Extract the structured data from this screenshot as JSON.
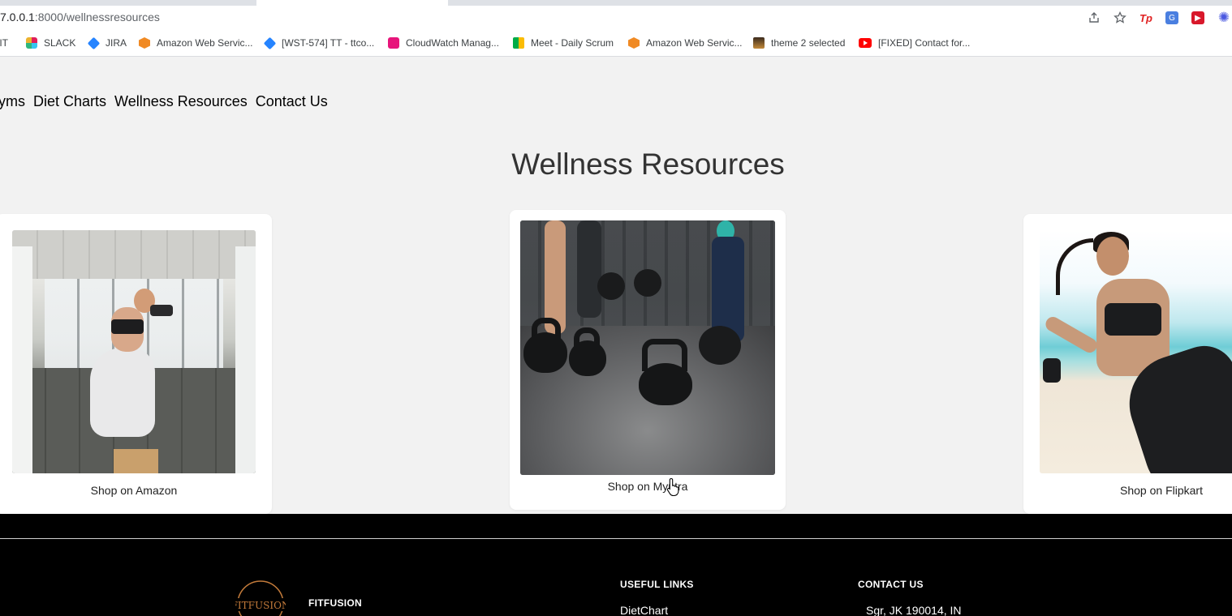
{
  "browser": {
    "url_prefix": "7.0.0.1",
    "url_rest": ":8000/wellnessresources",
    "bookmarks": [
      {
        "label": "GIT",
        "icon": "git-icon"
      },
      {
        "label": "SLACK",
        "icon": "slack-icon"
      },
      {
        "label": "JIRA",
        "icon": "jira-icon"
      },
      {
        "label": "Amazon Web Servic...",
        "icon": "aws-icon"
      },
      {
        "label": "[WST-574] TT - ttco...",
        "icon": "jira-icon"
      },
      {
        "label": "CloudWatch Manag...",
        "icon": "cloudwatch-icon"
      },
      {
        "label": "Meet - Daily Scrum",
        "icon": "google-meet-icon"
      },
      {
        "label": "Amazon Web Servic...",
        "icon": "aws-icon"
      },
      {
        "label": "theme 2 selected",
        "icon": "theme-icon"
      },
      {
        "label": "[FIXED] Contact for...",
        "icon": "youtube-icon"
      }
    ],
    "toolbar_icons": [
      "share-icon",
      "bookmark-star-icon",
      "tp-extension-icon",
      "translate-extension-icon",
      "red-extension-icon",
      "gear-extension-icon"
    ],
    "ext_tp_label": "Tp",
    "ext_tr_label": "G",
    "ext_red_label": "▶"
  },
  "nav": {
    "items": [
      "yms",
      "Diet Charts",
      "Wellness Resources",
      "Contact Us"
    ]
  },
  "page": {
    "title": "Wellness Resources"
  },
  "cards": [
    {
      "caption": "Shop on Amazon",
      "image": "woman squatting with dumbbell in gym"
    },
    {
      "caption": "Shop on Myntra",
      "image": "kettlebells on gym floor"
    },
    {
      "caption": "Shop on Flipkart",
      "image": "woman kicking on beach"
    }
  ],
  "footer": {
    "brand": "FITFUSION",
    "logo_text": "FITFUSION",
    "useful_links_heading": "USEFUL LINKS",
    "useful_links": [
      "DietChart"
    ],
    "contact_heading": "CONTACT US",
    "contact_address": "Sgr, JK 190014, IN"
  },
  "colors": {
    "page_bg": "#f2f2f2",
    "footer_bg": "#000000",
    "card_bg": "#ffffff"
  }
}
